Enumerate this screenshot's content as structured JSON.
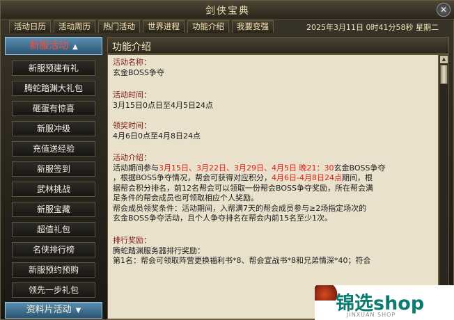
{
  "window": {
    "title": "剑侠宝典",
    "close": "✕"
  },
  "tabs": [
    "活动日历",
    "活动周历",
    "热门活动",
    "世界进程",
    "功能介绍",
    "我要变强"
  ],
  "clock": "2025年3月11日  0时41分58秒  星期二",
  "sidebar": {
    "head": "新服活动",
    "items": [
      "新服预建有礼",
      "腾蛇踏渊大礼包",
      "砸蛋有惊喜",
      "新服冲级",
      "充值送经验",
      "新服签到",
      "武林挑战",
      "新服宝藏",
      "超值礼包",
      "名侠排行榜",
      "新服预约预购",
      "领先一步礼包"
    ],
    "foot": "资料片活动"
  },
  "panel": {
    "title": "功能介绍"
  },
  "content": {
    "name_h": "活动名称：",
    "name": "玄金BOSS争夺",
    "time_h": "活动时间：",
    "time": "3月15日0点日至4月5日24点",
    "reward_time_h": "领奖时间：",
    "reward_time": "4月6日0点至4月8日24点",
    "intro_h": "活动介绍：",
    "intro_1a": "活动期间参与",
    "intro_1b": "3月15日、3月22日、3月29日、4月5日 晚21：30",
    "intro_1c": "玄金BOSS争夺",
    "intro_2a": "，根据BOSS争夺情况，帮会可获得对应积分，",
    "intro_2b": "4月6日-4月8日24点",
    "intro_2c": "期间，根",
    "intro_3": "据帮会积分排名，前12名帮会可以领取一份帮会BOSS争夺奖励，所在帮会满",
    "intro_4": "足条件的帮会成员也可领取相应个人奖励。",
    "intro_5": "帮会成员领奖条件：活动期间，入帮满7天的帮会成员参与≥2场指定场次的",
    "intro_6": "玄金BOSS争夺活动，且个人争夺排名在帮会内前15名至少1次。",
    "rank_h": "排行奖励：",
    "rank_1": "腾蛇踏渊服务器排行奖励：",
    "rank_2": "第1名：帮会可领取阵营更换福利书*8、帮会宣战书*8和兄弟情深*40；符合"
  },
  "watermark": {
    "main": "锦选shop",
    "sub": "JINXUAN SHOP"
  }
}
